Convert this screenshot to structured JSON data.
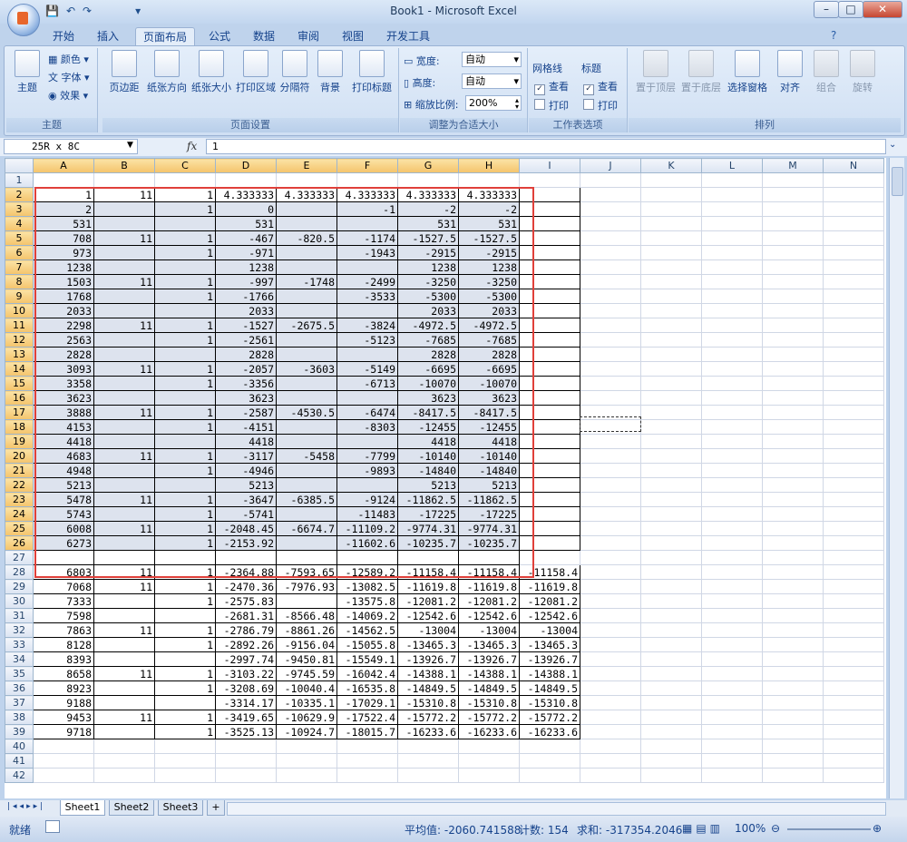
{
  "window": {
    "title": "Book1 - Microsoft Excel",
    "min": "–",
    "max": "□",
    "close": "✕"
  },
  "qat": {
    "undo": "↶",
    "redo": "↷",
    "save": "💾",
    "more": "▾"
  },
  "tabs": [
    "开始",
    "插入",
    "页面布局",
    "公式",
    "数据",
    "审阅",
    "视图",
    "开发工具"
  ],
  "ribbon": {
    "theme": {
      "label": "主题",
      "btn": "主题",
      "colors": "颜色",
      "fonts": "字体",
      "effects": "效果"
    },
    "pagesetup": {
      "label": "页面设置",
      "buttons": [
        "页边距",
        "纸张方向",
        "纸张大小",
        "打印区域",
        "分隔符",
        "背景",
        "打印标题"
      ]
    },
    "scale": {
      "label": "调整为合适大小",
      "width_label": "宽度:",
      "width_value": "自动",
      "height_label": "高度:",
      "height_value": "自动",
      "zoom_label": "缩放比例:",
      "zoom_value": "200%"
    },
    "sheetopts": {
      "label": "工作表选项",
      "gridlines": "网格线",
      "headings": "标题",
      "view": "查看",
      "print": "打印",
      "check": "✓"
    },
    "arrange": {
      "label": "排列",
      "buttons": [
        "置于顶层",
        "置于底层",
        "选择窗格",
        "对齐",
        "组合",
        "旋转"
      ]
    }
  },
  "formula_bar": {
    "namebox": "25R x 8C",
    "fx": "fx",
    "content": "1"
  },
  "columns": [
    "A",
    "B",
    "C",
    "D",
    "E",
    "F",
    "G",
    "H",
    "I",
    "J",
    "K",
    "L",
    "M",
    "N"
  ],
  "rows": [
    [
      "1",
      "11",
      "1",
      "4.333333",
      "4.333333",
      "4.333333",
      "4.333333",
      "4.333333",
      ""
    ],
    [
      "2",
      "",
      "1",
      "0",
      "",
      "-1",
      "-2",
      "-2",
      ""
    ],
    [
      "531",
      "",
      "",
      "531",
      "",
      "",
      "531",
      "531",
      ""
    ],
    [
      "708",
      "11",
      "1",
      "-467",
      "-820.5",
      "-1174",
      "-1527.5",
      "-1527.5",
      ""
    ],
    [
      "973",
      "",
      "1",
      "-971",
      "",
      "-1943",
      "-2915",
      "-2915",
      ""
    ],
    [
      "1238",
      "",
      "",
      "1238",
      "",
      "",
      "1238",
      "1238",
      ""
    ],
    [
      "1503",
      "11",
      "1",
      "-997",
      "-1748",
      "-2499",
      "-3250",
      "-3250",
      ""
    ],
    [
      "1768",
      "",
      "1",
      "-1766",
      "",
      "-3533",
      "-5300",
      "-5300",
      ""
    ],
    [
      "2033",
      "",
      "",
      "2033",
      "",
      "",
      "2033",
      "2033",
      ""
    ],
    [
      "2298",
      "11",
      "1",
      "-1527",
      "-2675.5",
      "-3824",
      "-4972.5",
      "-4972.5",
      ""
    ],
    [
      "2563",
      "",
      "1",
      "-2561",
      "",
      "-5123",
      "-7685",
      "-7685",
      ""
    ],
    [
      "2828",
      "",
      "",
      "2828",
      "",
      "",
      "2828",
      "2828",
      ""
    ],
    [
      "3093",
      "11",
      "1",
      "-2057",
      "-3603",
      "-5149",
      "-6695",
      "-6695",
      ""
    ],
    [
      "3358",
      "",
      "1",
      "-3356",
      "",
      "-6713",
      "-10070",
      "-10070",
      ""
    ],
    [
      "3623",
      "",
      "",
      "3623",
      "",
      "",
      "3623",
      "3623",
      ""
    ],
    [
      "3888",
      "11",
      "1",
      "-2587",
      "-4530.5",
      "-6474",
      "-8417.5",
      "-8417.5",
      ""
    ],
    [
      "4153",
      "",
      "1",
      "-4151",
      "",
      "-8303",
      "-12455",
      "-12455",
      ""
    ],
    [
      "4418",
      "",
      "",
      "4418",
      "",
      "",
      "4418",
      "4418",
      ""
    ],
    [
      "4683",
      "11",
      "1",
      "-3117",
      "-5458",
      "-7799",
      "-10140",
      "-10140",
      ""
    ],
    [
      "4948",
      "",
      "1",
      "-4946",
      "",
      "-9893",
      "-14840",
      "-14840",
      ""
    ],
    [
      "5213",
      "",
      "",
      "5213",
      "",
      "",
      "5213",
      "5213",
      ""
    ],
    [
      "5478",
      "11",
      "1",
      "-3647",
      "-6385.5",
      "-9124",
      "-11862.5",
      "-11862.5",
      ""
    ],
    [
      "5743",
      "",
      "1",
      "-5741",
      "",
      "-11483",
      "-17225",
      "-17225",
      ""
    ],
    [
      "6008",
      "11",
      "1",
      "-2048.45",
      "-6674.7",
      "-11109.2",
      "-9774.31",
      "-9774.31",
      ""
    ],
    [
      "6273",
      "",
      "1",
      "-2153.92",
      "",
      "-11602.6",
      "-10235.7",
      "-10235.7",
      ""
    ],
    [
      "",
      "",
      "",
      "",
      "",
      "",
      "",
      "",
      ""
    ],
    [
      "6803",
      "11",
      "1",
      "-2364.88",
      "-7593.65",
      "-12589.2",
      "-11158.4",
      "-11158.4",
      "-11158.4"
    ],
    [
      "7068",
      "11",
      "1",
      "-2470.36",
      "-7976.93",
      "-13082.5",
      "-11619.8",
      "-11619.8",
      "-11619.8"
    ],
    [
      "7333",
      "",
      "1",
      "-2575.83",
      "",
      "-13575.8",
      "-12081.2",
      "-12081.2",
      "-12081.2"
    ],
    [
      "7598",
      "",
      "",
      "-2681.31",
      "-8566.48",
      "-14069.2",
      "-12542.6",
      "-12542.6",
      "-12542.6"
    ],
    [
      "7863",
      "11",
      "1",
      "-2786.79",
      "-8861.26",
      "-14562.5",
      "-13004",
      "-13004",
      "-13004"
    ],
    [
      "8128",
      "",
      "1",
      "-2892.26",
      "-9156.04",
      "-15055.8",
      "-13465.3",
      "-13465.3",
      "-13465.3"
    ],
    [
      "8393",
      "",
      "",
      "-2997.74",
      "-9450.81",
      "-15549.1",
      "-13926.7",
      "-13926.7",
      "-13926.7"
    ],
    [
      "8658",
      "11",
      "1",
      "-3103.22",
      "-9745.59",
      "-16042.4",
      "-14388.1",
      "-14388.1",
      "-14388.1"
    ],
    [
      "8923",
      "",
      "1",
      "-3208.69",
      "-10040.4",
      "-16535.8",
      "-14849.5",
      "-14849.5",
      "-14849.5"
    ],
    [
      "9188",
      "",
      "",
      "-3314.17",
      "-10335.1",
      "-17029.1",
      "-15310.8",
      "-15310.8",
      "-15310.8"
    ],
    [
      "9453",
      "11",
      "1",
      "-3419.65",
      "-10629.9",
      "-17522.4",
      "-15772.2",
      "-15772.2",
      "-15772.2"
    ],
    [
      "9718",
      "",
      "1",
      "-3525.13",
      "-10924.7",
      "-18015.7",
      "-16233.6",
      "-16233.6",
      "-16233.6"
    ]
  ],
  "sheets": [
    "Sheet1",
    "Sheet2",
    "Sheet3"
  ],
  "status": {
    "ready": "就绪",
    "average": "平均值: -2060.741588",
    "count": "计数: 154",
    "sum": "求和: -317354.2046",
    "zoom": "100%"
  }
}
